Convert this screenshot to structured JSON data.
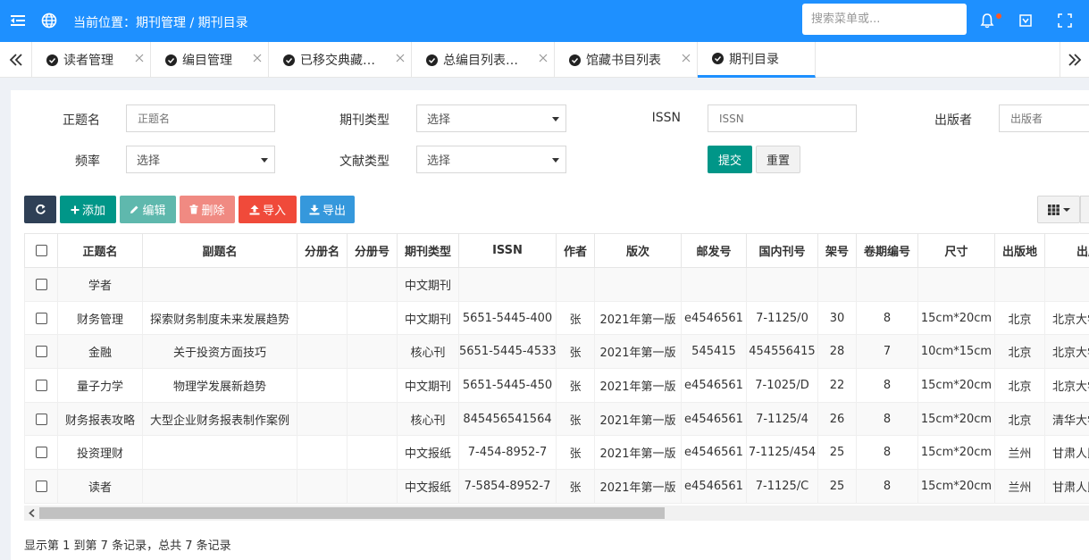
{
  "header": {
    "location_prefix": "当前位置：",
    "location_path": "期刊管理 / 期刊目录",
    "search_placeholder": "搜索菜单或..."
  },
  "tabs": [
    {
      "label": "读者管理",
      "active": false
    },
    {
      "label": "编目管理",
      "active": false
    },
    {
      "label": "已移交典藏…",
      "active": false
    },
    {
      "label": "总编目列表…",
      "active": false
    },
    {
      "label": "馆藏书目列表",
      "active": false
    },
    {
      "label": "期刊目录",
      "active": true
    }
  ],
  "form": {
    "title_label": "正题名",
    "title_placeholder": "正题名",
    "type_label": "期刊类型",
    "type_value": "选择",
    "issn_label": "ISSN",
    "issn_placeholder": "ISSN",
    "publisher_label": "出版者",
    "publisher_placeholder": "出版者",
    "freq_label": "频率",
    "freq_value": "选择",
    "doc_label": "文献类型",
    "doc_value": "选择",
    "submit": "提交",
    "reset": "重置"
  },
  "toolbar": {
    "add": "添加",
    "edit": "编辑",
    "delete": "删除",
    "import": "导入",
    "export": "导出"
  },
  "table": {
    "columns": [
      "正题名",
      "副题名",
      "分册名",
      "分册号",
      "期刊类型",
      "ISSN",
      "作者",
      "版次",
      "邮发号",
      "国内刊号",
      "架号",
      "卷期编号",
      "尺寸",
      "出版地",
      "出版者"
    ],
    "rows": [
      [
        "学者",
        "",
        "",
        "",
        "中文期刊",
        "",
        "",
        "",
        "",
        "",
        "",
        "",
        "",
        "",
        ""
      ],
      [
        "财务管理",
        "探索财务制度未来发展趋势",
        "",
        "",
        "中文期刊",
        "5651-5445-400",
        "张",
        "2021年第一版",
        "e4546561",
        "7-1125/0",
        "30",
        "8",
        "15cm*20cm",
        "北京",
        "北京大学"
      ],
      [
        "金融",
        "关于投资方面技巧",
        "",
        "",
        "核心刊",
        "5651-5445-4533",
        "张",
        "2021年第一版",
        "545415",
        "454556415",
        "28",
        "7",
        "10cm*15cm",
        "北京",
        "北京大学"
      ],
      [
        "量子力学",
        "物理学发展新趋势",
        "",
        "",
        "中文期刊",
        "5651-5445-450",
        "张",
        "2021年第一版",
        "e4546561",
        "7-1025/D",
        "22",
        "8",
        "15cm*20cm",
        "北京",
        "北京大学"
      ],
      [
        "财务报表攻略",
        "大型企业财务报表制作案例",
        "",
        "",
        "核心刊",
        "845456541564",
        "张",
        "2021年第一版",
        "e4546561",
        "7-1125/4",
        "26",
        "8",
        "15cm*20cm",
        "北京",
        "清华大学"
      ],
      [
        "投资理财",
        "",
        "",
        "",
        "中文报纸",
        "7-454-8952-7",
        "张",
        "2021年第一版",
        "e4546561",
        "7-1125/454",
        "25",
        "8",
        "15cm*20cm",
        "兰州",
        "甘肃人民"
      ],
      [
        "读者",
        "",
        "",
        "",
        "中文报纸",
        "7-5854-8952-7",
        "张",
        "2021年第一版",
        "e4546561",
        "7-1125/C",
        "25",
        "8",
        "15cm*20cm",
        "兰州",
        "甘肃人民"
      ]
    ]
  },
  "footer": {
    "summary": "显示第 1 到第 7 条记录，总共 7 条记录"
  },
  "colors": {
    "primary": "#1e90ff",
    "teal": "#009688",
    "teal_light": "#5fb8ad",
    "danger_light": "#f08a82",
    "danger": "#f04a3a",
    "info": "#3598dc",
    "dark": "#2f4056"
  }
}
